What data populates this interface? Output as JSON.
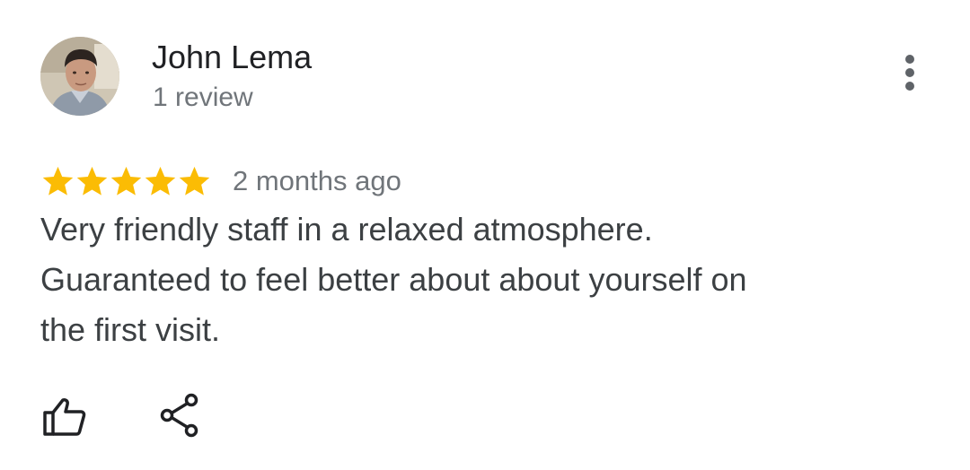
{
  "review": {
    "author_name": "John Lema",
    "review_count": "1 review",
    "rating": 5,
    "rating_max": 5,
    "date": "2 months ago",
    "lines": [
      "Very friendly staff in a relaxed atmosphere.",
      "Guaranteed to feel better about about yourself on",
      "the first visit."
    ]
  },
  "icons": {
    "avatar": "profile-photo",
    "more": "more-vertical-icon",
    "star": "star-icon",
    "like": "thumbs-up-outline-icon",
    "share": "share-icon"
  },
  "colors": {
    "star": "#fbbc04",
    "name": "#202124",
    "secondary_text": "#70757a",
    "body_text": "#3c4043",
    "icon": "#202124"
  }
}
